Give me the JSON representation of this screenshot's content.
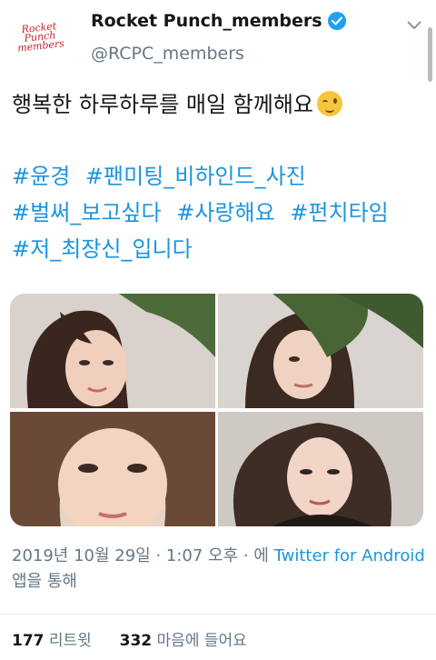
{
  "profile": {
    "avatar_text_line1": "Rocket Punch",
    "avatar_text_line2": "members",
    "display_name": "Rocket Punch_members",
    "handle": "@RCPC_members",
    "verified_icon": "verified-badge-icon",
    "menu_icon": "chevron-down-icon"
  },
  "tweet": {
    "text": "행복한 하루하루를 매일 함께해요",
    "emoji": "winking-face-emoji",
    "hashtags": [
      [
        "#윤경",
        "#팬미팅_비하인드_사진"
      ],
      [
        "#벌써_보고싶다",
        "#사랑해요",
        "#펀치타임"
      ],
      [
        "#저_최장신_입니다"
      ]
    ]
  },
  "media": {
    "photos": [
      "photo-1",
      "photo-2",
      "photo-3",
      "photo-4"
    ]
  },
  "meta": {
    "date": "2019년 10월 29일 · 1:07 오후 · 에",
    "source": "Twitter for Android",
    "suffix": "앱을 통해"
  },
  "stats": {
    "retweets_count": "177",
    "retweets_label": "리트윗",
    "likes_count": "332",
    "likes_label": "마음에 들어요"
  },
  "colors": {
    "link": "#1b95e0",
    "secondary": "#657786",
    "brand_logo": "#c8242e",
    "verified": "#1da1f2"
  }
}
